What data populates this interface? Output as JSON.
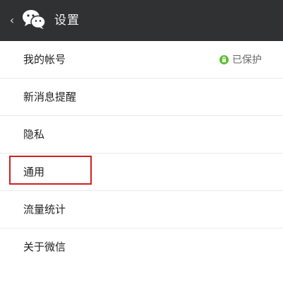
{
  "header": {
    "back_icon": "chevron-left-icon",
    "logo_icon": "wechat-logo-icon",
    "title": "设置"
  },
  "menu": {
    "items": [
      {
        "label": "我的帐号",
        "status": "已保护",
        "status_icon": "lock-icon"
      },
      {
        "label": "新消息提醒"
      },
      {
        "label": "隐私"
      },
      {
        "label": "通用"
      },
      {
        "label": "流量统计"
      },
      {
        "label": "关于微信"
      }
    ]
  },
  "colors": {
    "header_bg": "#303133",
    "protected_green": "#59c130",
    "highlight_border": "#d02020"
  }
}
